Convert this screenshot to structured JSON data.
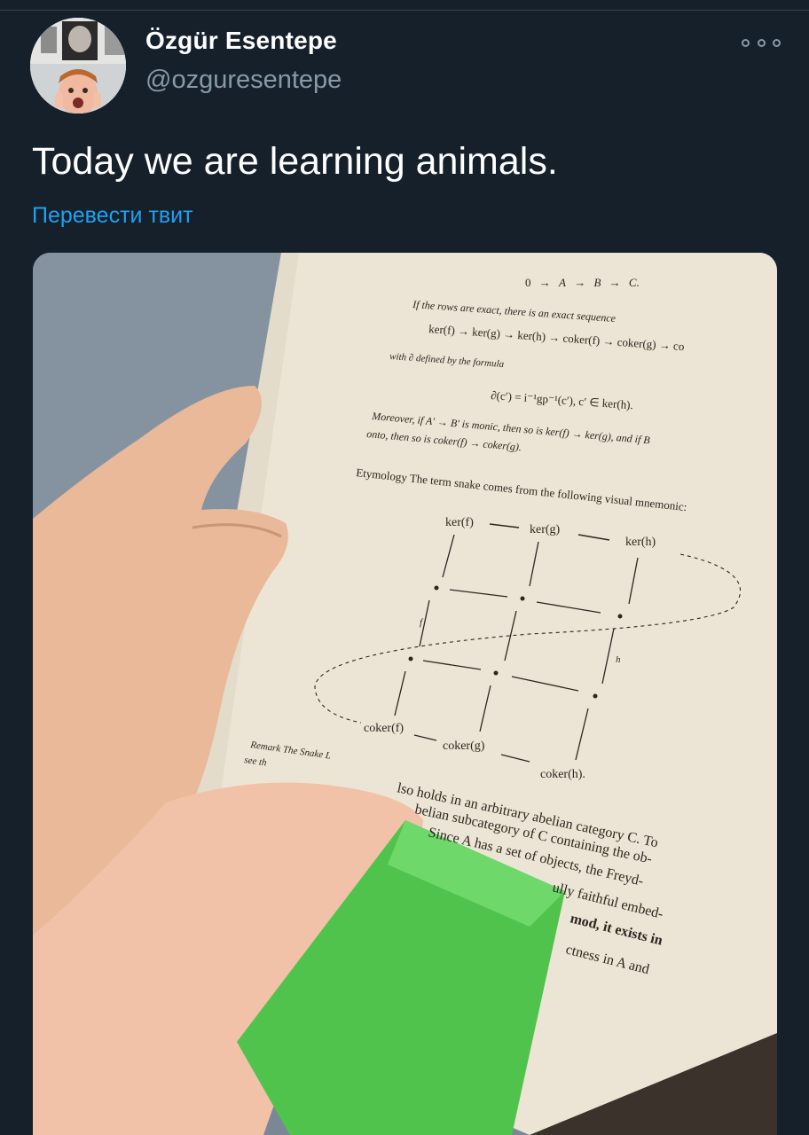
{
  "author": {
    "display_name": "Özgür Esentepe",
    "handle": "@ozguresentepe"
  },
  "tweet": {
    "text": "Today we are learning animals.",
    "translate_label": "Перевести твит"
  },
  "menu": {
    "icon": "more-dots-icon"
  },
  "media": {
    "page_lines": [
      "If the rows are exact, there is an exact sequence",
      "ker(f) → ker(g) → ker(h) → coker(f) → coker(g) → co",
      "with ∂ defined by the formula",
      "∂(c′) = i⁻¹gp⁻¹(c′),   c′ ∈ ker(h).",
      "Moreover, if A′ → B′ is monic, then so is ker(f) → ker(g), and if B",
      "onto, then so is coker(f) → coker(g).",
      "Etymology  The term snake comes from the following visual mnemonic:",
      "Remark  The Snake L",
      "see th",
      "lso holds in an arbitrary abelian category C. To",
      "belian subcategory of C containing the ob-",
      "Since A has a set of objects, the Freyd-",
      "ully faithful embed-",
      "mod, it exists in",
      "ctness in A and"
    ],
    "top_row": [
      "0",
      "→",
      "A",
      "→",
      "B",
      "→",
      "C."
    ],
    "diagram_top": [
      "ker(f)",
      "ker(g)",
      "ker(h)"
    ],
    "diagram_bottom": [
      "coker(f)",
      "coker(g)",
      "coker(h)."
    ],
    "diagram_labels": [
      "f",
      "h"
    ]
  }
}
